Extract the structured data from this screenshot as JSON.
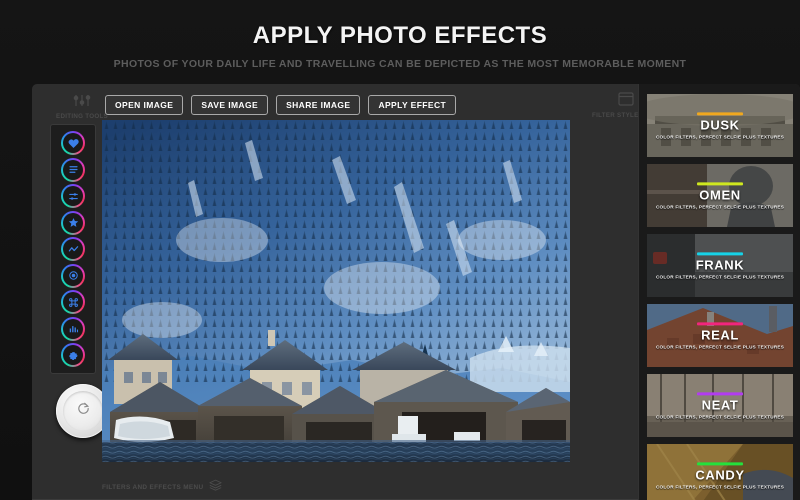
{
  "header": {
    "title": "APPLY PHOTO EFFECTS",
    "subtitle": "PHOTOS OF YOUR DAILY LIFE AND TRAVELLING CAN BE DEPICTED AS THE MOST MEMORABLE MOMENT"
  },
  "toolbar": {
    "buttons": [
      {
        "label": "OPEN IMAGE",
        "name": "open-image-button"
      },
      {
        "label": "SAVE IMAGE",
        "name": "save-image-button"
      },
      {
        "label": "SHARE IMAGE",
        "name": "share-image-button"
      },
      {
        "label": "APPLY EFFECT",
        "name": "apply-effect-button"
      }
    ],
    "editing_tools_label": "EDITING TOOLS",
    "editing_tools_icon": "sliders-icon",
    "filter_style_label": "FILTER STYLE MENU",
    "filter_style_icon": "window-panel-icon"
  },
  "tool_rail": {
    "items": [
      {
        "icon": "heart-icon",
        "name": "tool-favorites"
      },
      {
        "icon": "lines-icon",
        "name": "tool-presets"
      },
      {
        "icon": "adjust-sliders-icon",
        "name": "tool-adjust"
      },
      {
        "icon": "star-icon",
        "name": "tool-effects"
      },
      {
        "icon": "wave-icon",
        "name": "tool-curves"
      },
      {
        "icon": "target-icon",
        "name": "tool-focus"
      },
      {
        "icon": "command-icon",
        "name": "tool-shortcuts"
      },
      {
        "icon": "bar-chart-icon",
        "name": "tool-histogram"
      },
      {
        "icon": "gear-icon",
        "name": "tool-settings"
      }
    ],
    "reset_button_icon": "reset-rotate-icon"
  },
  "canvas": {
    "photo_description": "Snowy alpine mountainside above lakeside wooden boathouses",
    "bottom_label": "FILTERS AND EFFECTS MENU",
    "bottom_icon": "layers-icon"
  },
  "filter_panel": {
    "subtitle_common": "COLOR FILTERS, PERFECT SELFIE PLUS TEXTURES",
    "cards": [
      {
        "name": "DUSK",
        "bar_color": "#f0a81e",
        "selected": true,
        "thumb_a": "#b8b3a4",
        "thumb_b": "#6f6a5e"
      },
      {
        "name": "OMEN",
        "bar_color": "#cfe81f",
        "selected": false,
        "thumb_a": "#8a8780",
        "thumb_b": "#4d4a46"
      },
      {
        "name": "FRANK",
        "bar_color": "#16d2e8",
        "selected": false,
        "thumb_a": "#7d7f80",
        "thumb_b": "#3a3b3c"
      },
      {
        "name": "REAL",
        "bar_color": "#f2257d",
        "selected": false,
        "thumb_a": "#9c5c42",
        "thumb_b": "#5a3a31"
      },
      {
        "name": "NEAT",
        "bar_color": "#b23cf0",
        "selected": false,
        "thumb_a": "#a79b8c",
        "thumb_b": "#5e574f"
      },
      {
        "name": "CANDY",
        "bar_color": "#24e03c",
        "selected": false,
        "thumb_a": "#b08d4a",
        "thumb_b": "#6b5530"
      }
    ]
  },
  "colors": {
    "page_bg": "#121212",
    "window_bg": "#2e2e2e",
    "panel_bg": "#1a1a1a",
    "accent_text": "#ffffff"
  }
}
